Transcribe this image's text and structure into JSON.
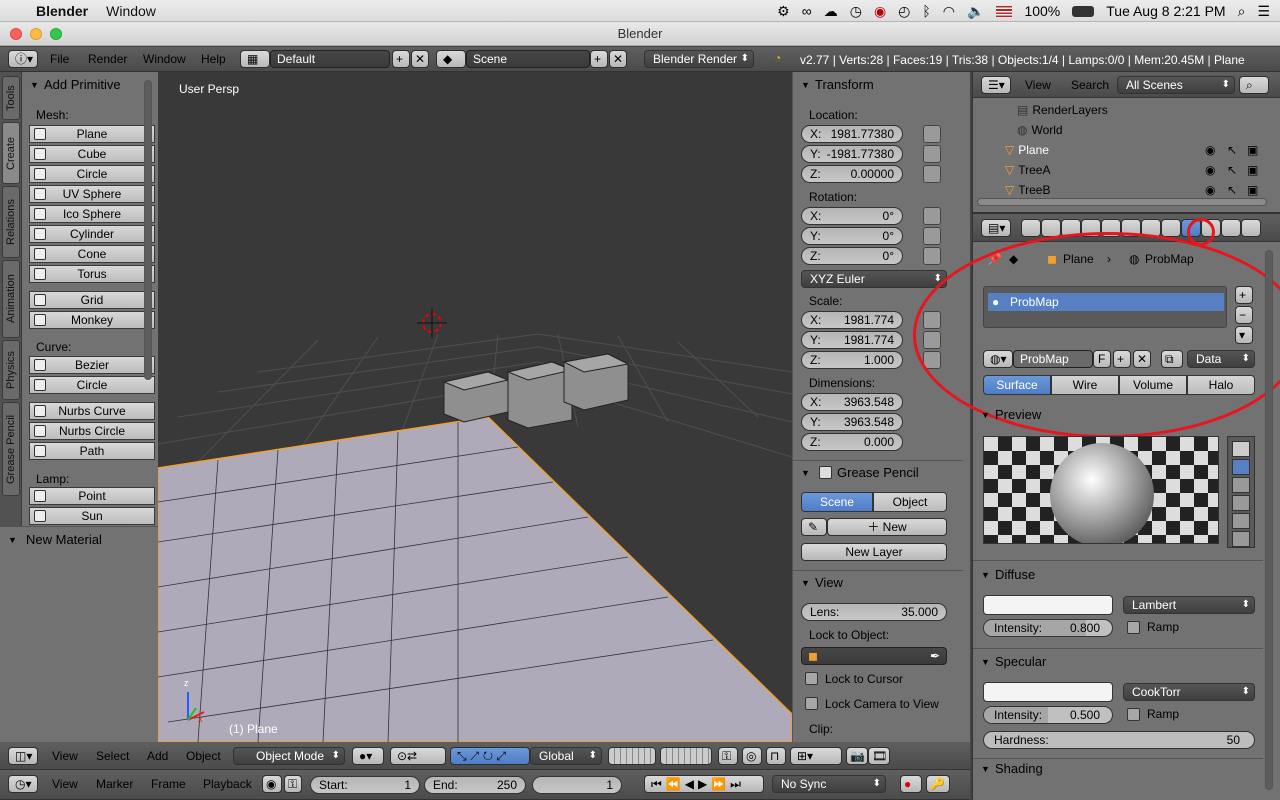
{
  "macbar": {
    "app": "Blender",
    "menu_window": "Window",
    "battery": "100%",
    "datetime": "Tue Aug 8  2:21 PM"
  },
  "window": {
    "title": "Blender"
  },
  "infobar": {
    "menus": [
      "File",
      "Render",
      "Window",
      "Help"
    ],
    "layout": "Default",
    "scene": "Scene",
    "engine": "Blender Render",
    "stats": "v2.77 | Verts:28 | Faces:19 | Tris:38 | Objects:1/4 | Lamps:0/0 | Mem:20.45M | Plane"
  },
  "toolshelf": {
    "tabs": [
      "Tools",
      "Create",
      "Relations",
      "Animation",
      "Physics",
      "Grease Pencil"
    ],
    "panel_title": "Add Primitive",
    "mesh_label": "Mesh:",
    "mesh": [
      "Plane",
      "Cube",
      "Circle",
      "UV Sphere",
      "Ico Sphere",
      "Cylinder",
      "Cone",
      "Torus"
    ],
    "mesh2": [
      "Grid",
      "Monkey"
    ],
    "curve_label": "Curve:",
    "curve": [
      "Bezier",
      "Circle"
    ],
    "curve2": [
      "Nurbs Curve",
      "Nurbs Circle",
      "Path"
    ],
    "lamp_label": "Lamp:",
    "lamp": [
      "Point",
      "Sun"
    ],
    "new_material": "New Material"
  },
  "viewport": {
    "label": "User Persp",
    "object_label": "(1) Plane",
    "axis_z": "z",
    "axis_x": "x"
  },
  "npanel": {
    "transform": "Transform",
    "location_label": "Location:",
    "location": [
      {
        "k": "X:",
        "v": "1981.77380"
      },
      {
        "k": "Y:",
        "v": "-1981.77380"
      },
      {
        "k": "Z:",
        "v": "0.00000"
      }
    ],
    "rotation_label": "Rotation:",
    "rotation": [
      {
        "k": "X:",
        "v": "0°"
      },
      {
        "k": "Y:",
        "v": "0°"
      },
      {
        "k": "Z:",
        "v": "0°"
      }
    ],
    "euler": "XYZ Euler",
    "scale_label": "Scale:",
    "scale": [
      {
        "k": "X:",
        "v": "1981.774"
      },
      {
        "k": "Y:",
        "v": "1981.774"
      },
      {
        "k": "Z:",
        "v": "1.000"
      }
    ],
    "dimensions_label": "Dimensions:",
    "dimensions": [
      {
        "k": "X:",
        "v": "3963.548"
      },
      {
        "k": "Y:",
        "v": "3963.548"
      },
      {
        "k": "Z:",
        "v": "0.000"
      }
    ],
    "grease_pencil": "Grease Pencil",
    "gp_scene": "Scene",
    "gp_object": "Object",
    "gp_new": "New",
    "gp_new_layer": "New Layer",
    "view": "View",
    "lens_label": "Lens:",
    "lens_value": "35.000",
    "lock_to_object": "Lock to Object:",
    "lock_to_cursor": "Lock to Cursor",
    "lock_camera": "Lock Camera to View",
    "clip": "Clip:"
  },
  "outliner": {
    "menus": [
      "View",
      "Search"
    ],
    "filter": "All Scenes",
    "rows": [
      {
        "name": "RenderLayers"
      },
      {
        "name": "World"
      },
      {
        "name": "Plane"
      },
      {
        "name": "TreeA"
      },
      {
        "name": "TreeB"
      }
    ]
  },
  "properties": {
    "crumb_object": "Plane",
    "crumb_material": "ProbMap",
    "slot": "ProbMap",
    "material_name": "ProbMap",
    "fake_user": "F",
    "link": "Data",
    "tabs": [
      "Surface",
      "Wire",
      "Volume",
      "Halo"
    ],
    "preview": "Preview",
    "diffuse": "Diffuse",
    "diffuse_shader": "Lambert",
    "diffuse_intensity_label": "Intensity:",
    "diffuse_intensity": "0.800",
    "diffuse_intensity_fraction": 0.8,
    "ramp": "Ramp",
    "specular": "Specular",
    "specular_shader": "CookTorr",
    "specular_intensity_label": "Intensity:",
    "specular_intensity": "0.500",
    "specular_intensity_fraction": 0.5,
    "hardness_label": "Hardness:",
    "hardness": "50",
    "shading": "Shading"
  },
  "view3d_header": {
    "menus": [
      "View",
      "Select",
      "Add",
      "Object"
    ],
    "mode": "Object Mode",
    "orientation": "Global"
  },
  "timeline": {
    "menus": [
      "View",
      "Marker",
      "Frame",
      "Playback"
    ],
    "start_label": "Start:",
    "start": "1",
    "end_label": "End:",
    "end": "250",
    "current": "1",
    "sync": "No Sync"
  },
  "colors": {
    "accent_blue": "#5680c2",
    "annotation_red": "#e8141e",
    "selection_orange": "#f0a030"
  }
}
